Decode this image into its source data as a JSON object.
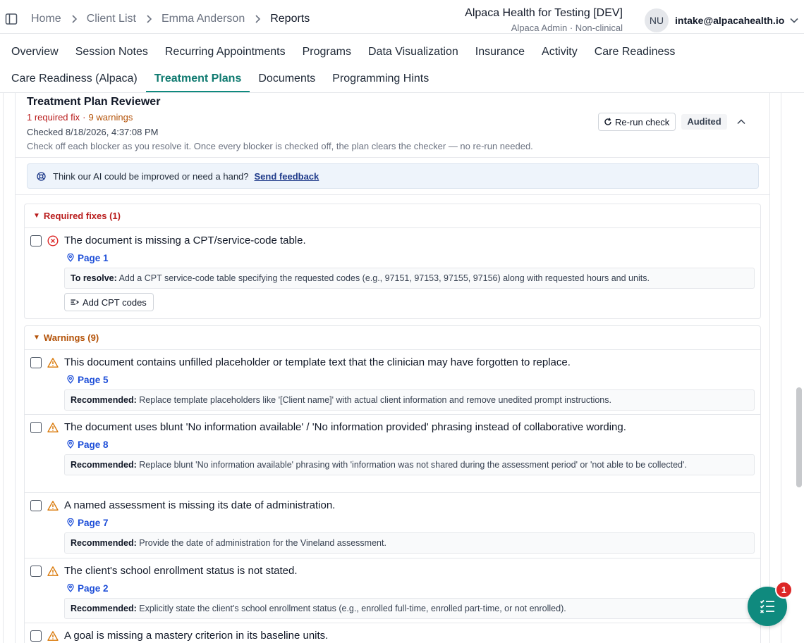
{
  "breadcrumb": [
    {
      "label": "Home"
    },
    {
      "label": "Client List"
    },
    {
      "label": "Emma Anderson"
    },
    {
      "label": "Reports"
    }
  ],
  "org": {
    "name": "Alpaca Health for Testing [DEV]",
    "role": "Alpaca Admin · Non-clinical"
  },
  "user": {
    "initials": "NU",
    "email": "intake@alpacahealth.io"
  },
  "tabs_row1": [
    "Overview",
    "Session Notes",
    "Recurring Appointments",
    "Programs",
    "Data Visualization",
    "Insurance",
    "Activity",
    "Care Readiness"
  ],
  "tabs_row2": [
    "Care Readiness (Alpaca)",
    "Treatment Plans",
    "Documents",
    "Programming Hints"
  ],
  "active_tab": "Treatment Plans",
  "reviewer": {
    "title": "Treatment Plan Reviewer",
    "fix_count": "1 required fix",
    "separator": "·",
    "warn_count": "9 warnings",
    "checked": "Checked 8/18/2026, 4:37:08 PM",
    "help": "Check off each blocker as you resolve it. Once every blocker is checked off, the plan clears the checker — no re-run needed.",
    "rerun_label": "Re-run check",
    "status_badge": "Audited"
  },
  "feedback": {
    "text": "Think our AI could be improved or need a hand?",
    "link": "Send feedback"
  },
  "required": {
    "heading": "Required fixes (1)",
    "items": [
      {
        "text": "The document is missing a CPT/service-code table.",
        "page": "Page 1",
        "rec_label": "To resolve:",
        "rec_text": "Add a CPT service-code table specifying the requested codes (e.g., 97151, 97153, 97155, 97156) along with requested hours and units.",
        "action": "Add CPT codes"
      }
    ]
  },
  "warnings": {
    "heading": "Warnings (9)",
    "items": [
      {
        "text": "This document contains unfilled placeholder or template text that the clinician may have forgotten to replace.",
        "page": "Page 5",
        "rec_label": "Recommended:",
        "rec_text": "Replace template placeholders like '[Client name]' with actual client information and remove unedited prompt instructions."
      },
      {
        "text": "The document uses blunt 'No information available' / 'No information provided' phrasing instead of collaborative wording.",
        "page": "Page 8",
        "rec_label": "Recommended:",
        "rec_text": "Replace blunt 'No information available' phrasing with 'information was not shared during the assessment period' or 'not able to be collected'."
      },
      {
        "text": "A named assessment is missing its date of administration.",
        "page": "Page 7",
        "rec_label": "Recommended:",
        "rec_text": "Provide the date of administration for the Vineland assessment."
      },
      {
        "text": "The client's school enrollment status is not stated.",
        "page": "Page 2",
        "rec_label": "Recommended:",
        "rec_text": "Explicitly state the client's school enrollment status (e.g., enrolled full-time, enrolled part-time, or not enrolled)."
      },
      {
        "text": "A goal is missing a mastery criterion in its baseline units."
      }
    ]
  },
  "fab": {
    "badge": "1"
  },
  "colors": {
    "accent": "#0f8a7e",
    "error": "#b91c1c",
    "warning": "#b45309",
    "link": "#1d4ed8"
  }
}
